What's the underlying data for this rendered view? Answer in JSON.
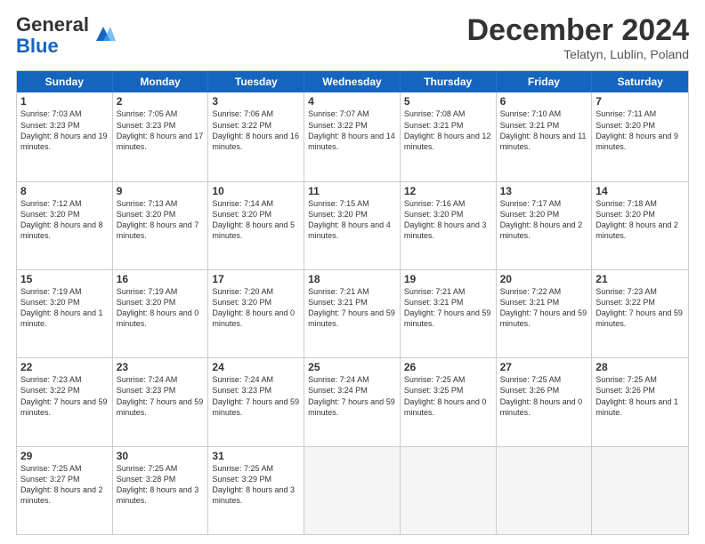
{
  "header": {
    "logo_general": "General",
    "logo_blue": "Blue",
    "month": "December 2024",
    "location": "Telatyn, Lublin, Poland"
  },
  "days": [
    "Sunday",
    "Monday",
    "Tuesday",
    "Wednesday",
    "Thursday",
    "Friday",
    "Saturday"
  ],
  "weeks": [
    [
      {
        "day": "1",
        "sunrise": "7:03 AM",
        "sunset": "3:23 PM",
        "daylight": "8 hours and 19 minutes."
      },
      {
        "day": "2",
        "sunrise": "7:05 AM",
        "sunset": "3:23 PM",
        "daylight": "8 hours and 17 minutes."
      },
      {
        "day": "3",
        "sunrise": "7:06 AM",
        "sunset": "3:22 PM",
        "daylight": "8 hours and 16 minutes."
      },
      {
        "day": "4",
        "sunrise": "7:07 AM",
        "sunset": "3:22 PM",
        "daylight": "8 hours and 14 minutes."
      },
      {
        "day": "5",
        "sunrise": "7:08 AM",
        "sunset": "3:21 PM",
        "daylight": "8 hours and 12 minutes."
      },
      {
        "day": "6",
        "sunrise": "7:10 AM",
        "sunset": "3:21 PM",
        "daylight": "8 hours and 11 minutes."
      },
      {
        "day": "7",
        "sunrise": "7:11 AM",
        "sunset": "3:20 PM",
        "daylight": "8 hours and 9 minutes."
      }
    ],
    [
      {
        "day": "8",
        "sunrise": "7:12 AM",
        "sunset": "3:20 PM",
        "daylight": "8 hours and 8 minutes."
      },
      {
        "day": "9",
        "sunrise": "7:13 AM",
        "sunset": "3:20 PM",
        "daylight": "8 hours and 7 minutes."
      },
      {
        "day": "10",
        "sunrise": "7:14 AM",
        "sunset": "3:20 PM",
        "daylight": "8 hours and 5 minutes."
      },
      {
        "day": "11",
        "sunrise": "7:15 AM",
        "sunset": "3:20 PM",
        "daylight": "8 hours and 4 minutes."
      },
      {
        "day": "12",
        "sunrise": "7:16 AM",
        "sunset": "3:20 PM",
        "daylight": "8 hours and 3 minutes."
      },
      {
        "day": "13",
        "sunrise": "7:17 AM",
        "sunset": "3:20 PM",
        "daylight": "8 hours and 2 minutes."
      },
      {
        "day": "14",
        "sunrise": "7:18 AM",
        "sunset": "3:20 PM",
        "daylight": "8 hours and 2 minutes."
      }
    ],
    [
      {
        "day": "15",
        "sunrise": "7:19 AM",
        "sunset": "3:20 PM",
        "daylight": "8 hours and 1 minute."
      },
      {
        "day": "16",
        "sunrise": "7:19 AM",
        "sunset": "3:20 PM",
        "daylight": "8 hours and 0 minutes."
      },
      {
        "day": "17",
        "sunrise": "7:20 AM",
        "sunset": "3:20 PM",
        "daylight": "8 hours and 0 minutes."
      },
      {
        "day": "18",
        "sunrise": "7:21 AM",
        "sunset": "3:21 PM",
        "daylight": "7 hours and 59 minutes."
      },
      {
        "day": "19",
        "sunrise": "7:21 AM",
        "sunset": "3:21 PM",
        "daylight": "7 hours and 59 minutes."
      },
      {
        "day": "20",
        "sunrise": "7:22 AM",
        "sunset": "3:21 PM",
        "daylight": "7 hours and 59 minutes."
      },
      {
        "day": "21",
        "sunrise": "7:23 AM",
        "sunset": "3:22 PM",
        "daylight": "7 hours and 59 minutes."
      }
    ],
    [
      {
        "day": "22",
        "sunrise": "7:23 AM",
        "sunset": "3:22 PM",
        "daylight": "7 hours and 59 minutes."
      },
      {
        "day": "23",
        "sunrise": "7:24 AM",
        "sunset": "3:23 PM",
        "daylight": "7 hours and 59 minutes."
      },
      {
        "day": "24",
        "sunrise": "7:24 AM",
        "sunset": "3:23 PM",
        "daylight": "7 hours and 59 minutes."
      },
      {
        "day": "25",
        "sunrise": "7:24 AM",
        "sunset": "3:24 PM",
        "daylight": "7 hours and 59 minutes."
      },
      {
        "day": "26",
        "sunrise": "7:25 AM",
        "sunset": "3:25 PM",
        "daylight": "8 hours and 0 minutes."
      },
      {
        "day": "27",
        "sunrise": "7:25 AM",
        "sunset": "3:26 PM",
        "daylight": "8 hours and 0 minutes."
      },
      {
        "day": "28",
        "sunrise": "7:25 AM",
        "sunset": "3:26 PM",
        "daylight": "8 hours and 1 minute."
      }
    ],
    [
      {
        "day": "29",
        "sunrise": "7:25 AM",
        "sunset": "3:27 PM",
        "daylight": "8 hours and 2 minutes."
      },
      {
        "day": "30",
        "sunrise": "7:25 AM",
        "sunset": "3:28 PM",
        "daylight": "8 hours and 3 minutes."
      },
      {
        "day": "31",
        "sunrise": "7:25 AM",
        "sunset": "3:29 PM",
        "daylight": "8 hours and 3 minutes."
      },
      null,
      null,
      null,
      null
    ]
  ]
}
